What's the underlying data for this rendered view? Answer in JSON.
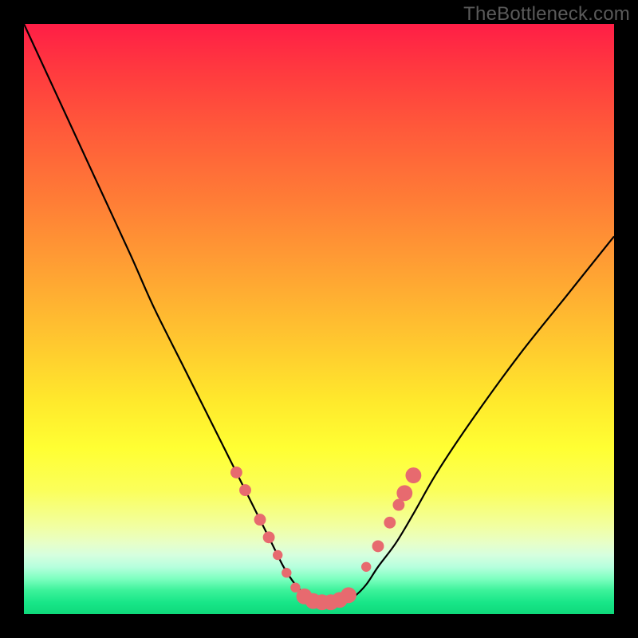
{
  "watermark": "TheBottleneck.com",
  "chart_data": {
    "type": "line",
    "title": "",
    "xlabel": "",
    "ylabel": "",
    "xlim": [
      0,
      100
    ],
    "ylim": [
      0,
      100
    ],
    "series": [
      {
        "name": "bottleneck-curve",
        "x": [
          0,
          6,
          12,
          18,
          22,
          27,
          31,
          34,
          37,
          40,
          42,
          44,
          46,
          48,
          50,
          52,
          54,
          56,
          58,
          60,
          63,
          66,
          70,
          76,
          84,
          92,
          100
        ],
        "values": [
          100,
          87,
          74,
          61,
          52,
          42,
          34,
          28,
          22,
          16,
          12,
          8,
          5,
          3,
          2,
          2,
          2,
          3,
          5,
          8,
          12,
          17,
          24,
          33,
          44,
          54,
          64
        ]
      }
    ],
    "markers": {
      "name": "highlighted-points",
      "points": [
        {
          "x": 36.0,
          "y": 24.0,
          "r": 1.2
        },
        {
          "x": 37.5,
          "y": 21.0,
          "r": 1.2
        },
        {
          "x": 40.0,
          "y": 16.0,
          "r": 1.2
        },
        {
          "x": 41.5,
          "y": 13.0,
          "r": 1.2
        },
        {
          "x": 43.0,
          "y": 10.0,
          "r": 1.0
        },
        {
          "x": 44.5,
          "y": 7.0,
          "r": 1.0
        },
        {
          "x": 46.0,
          "y": 4.5,
          "r": 1.0
        },
        {
          "x": 47.5,
          "y": 3.0,
          "r": 1.6
        },
        {
          "x": 49.0,
          "y": 2.2,
          "r": 1.6
        },
        {
          "x": 50.5,
          "y": 2.0,
          "r": 1.6
        },
        {
          "x": 52.0,
          "y": 2.0,
          "r": 1.6
        },
        {
          "x": 53.5,
          "y": 2.4,
          "r": 1.6
        },
        {
          "x": 55.0,
          "y": 3.2,
          "r": 1.6
        },
        {
          "x": 58.0,
          "y": 8.0,
          "r": 1.0
        },
        {
          "x": 60.0,
          "y": 11.5,
          "r": 1.2
        },
        {
          "x": 62.0,
          "y": 15.5,
          "r": 1.2
        },
        {
          "x": 63.5,
          "y": 18.5,
          "r": 1.2
        },
        {
          "x": 64.5,
          "y": 20.5,
          "r": 1.6
        },
        {
          "x": 66.0,
          "y": 23.5,
          "r": 1.6
        }
      ]
    },
    "background": {
      "type": "vertical-gradient",
      "stops": [
        {
          "pos": 0.0,
          "color": "#ff1e46"
        },
        {
          "pos": 0.35,
          "color": "#ff9a34"
        },
        {
          "pos": 0.7,
          "color": "#fff62e"
        },
        {
          "pos": 0.9,
          "color": "#d6ffdf"
        },
        {
          "pos": 1.0,
          "color": "#0fd97b"
        }
      ]
    }
  }
}
